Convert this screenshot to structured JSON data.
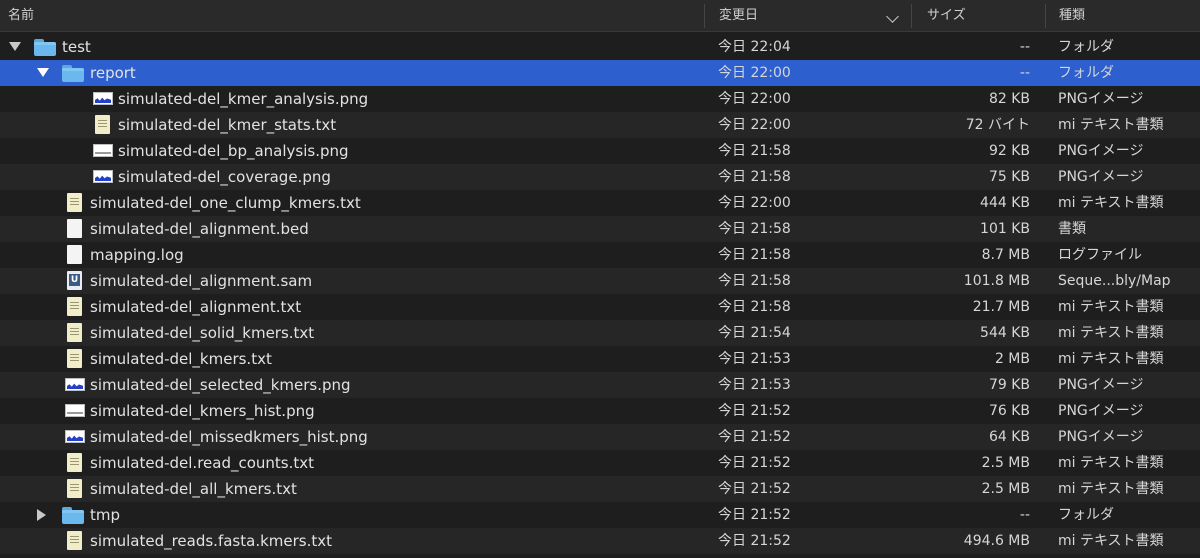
{
  "columns": {
    "name": "名前",
    "date": "変更日",
    "size": "サイズ",
    "kind": "種類"
  },
  "rows": [
    {
      "name": "test",
      "date": "今日 22:04",
      "size": "--",
      "kind": "フォルダ",
      "depth": 0,
      "icon": "folder-icon",
      "disclosure": "open"
    },
    {
      "name": "report",
      "date": "今日 22:00",
      "size": "--",
      "kind": "フォルダ",
      "depth": 1,
      "icon": "folder-icon",
      "disclosure": "open",
      "selected": true
    },
    {
      "name": "simulated-del_kmer_analysis.png",
      "date": "今日 22:00",
      "size": "82 KB",
      "kind": "PNGイメージ",
      "depth": 2,
      "icon": "image-wave-icon"
    },
    {
      "name": "simulated-del_kmer_stats.txt",
      "date": "今日 22:00",
      "size": "72 バイト",
      "kind": "mi テキスト書類",
      "depth": 2,
      "icon": "text-document-icon"
    },
    {
      "name": "simulated-del_bp_analysis.png",
      "date": "今日 21:58",
      "size": "92 KB",
      "kind": "PNGイメージ",
      "depth": 2,
      "icon": "image-line-icon"
    },
    {
      "name": "simulated-del_coverage.png",
      "date": "今日 21:58",
      "size": "75 KB",
      "kind": "PNGイメージ",
      "depth": 2,
      "icon": "image-wave-icon"
    },
    {
      "name": "simulated-del_one_clump_kmers.txt",
      "date": "今日 22:00",
      "size": "444 KB",
      "kind": "mi テキスト書類",
      "depth": 1,
      "icon": "text-document-icon"
    },
    {
      "name": "simulated-del_alignment.bed",
      "date": "今日 21:58",
      "size": "101 KB",
      "kind": "書類",
      "depth": 1,
      "icon": "blank-document-icon"
    },
    {
      "name": "mapping.log",
      "date": "今日 21:58",
      "size": "8.7 MB",
      "kind": "ログファイル",
      "depth": 1,
      "icon": "blank-document-icon"
    },
    {
      "name": "simulated-del_alignment.sam",
      "date": "今日 21:58",
      "size": "101.8 MB",
      "kind": "Seque...bly/Map",
      "depth": 1,
      "icon": "sam-document-icon"
    },
    {
      "name": "simulated-del_alignment.txt",
      "date": "今日 21:58",
      "size": "21.7 MB",
      "kind": "mi テキスト書類",
      "depth": 1,
      "icon": "text-document-icon"
    },
    {
      "name": "simulated-del_solid_kmers.txt",
      "date": "今日 21:54",
      "size": "544 KB",
      "kind": "mi テキスト書類",
      "depth": 1,
      "icon": "text-document-icon"
    },
    {
      "name": "simulated-del_kmers.txt",
      "date": "今日 21:53",
      "size": "2 MB",
      "kind": "mi テキスト書類",
      "depth": 1,
      "icon": "text-document-icon"
    },
    {
      "name": "simulated-del_selected_kmers.png",
      "date": "今日 21:53",
      "size": "79 KB",
      "kind": "PNGイメージ",
      "depth": 1,
      "icon": "image-wave-icon"
    },
    {
      "name": "simulated-del_kmers_hist.png",
      "date": "今日 21:52",
      "size": "76 KB",
      "kind": "PNGイメージ",
      "depth": 1,
      "icon": "image-line-icon"
    },
    {
      "name": "simulated-del_missedkmers_hist.png",
      "date": "今日 21:52",
      "size": "64 KB",
      "kind": "PNGイメージ",
      "depth": 1,
      "icon": "image-wave-icon"
    },
    {
      "name": "simulated-del.read_counts.txt",
      "date": "今日 21:52",
      "size": "2.5 MB",
      "kind": "mi テキスト書類",
      "depth": 1,
      "icon": "text-document-icon"
    },
    {
      "name": "simulated-del_all_kmers.txt",
      "date": "今日 21:52",
      "size": "2.5 MB",
      "kind": "mi テキスト書類",
      "depth": 1,
      "icon": "text-document-icon"
    },
    {
      "name": "tmp",
      "date": "今日 21:52",
      "size": "--",
      "kind": "フォルダ",
      "depth": 1,
      "icon": "folder-icon",
      "disclosure": "closed"
    },
    {
      "name": "simulated_reads.fasta.kmers.txt",
      "date": "今日 21:52",
      "size": "494.6 MB",
      "kind": "mi テキスト書類",
      "depth": 1,
      "icon": "text-document-icon"
    }
  ]
}
